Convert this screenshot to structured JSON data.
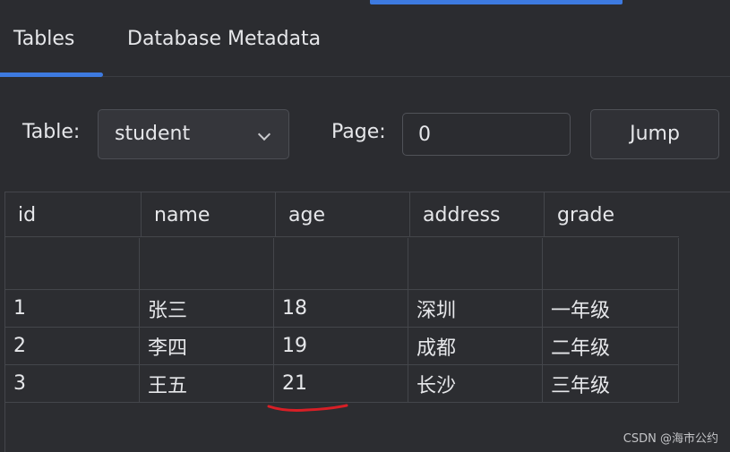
{
  "tabs": [
    {
      "label": "Tables",
      "active": true
    },
    {
      "label": "Database Metadata",
      "active": false
    }
  ],
  "toolbar": {
    "table_label": "Table:",
    "table_value": "student",
    "page_label": "Page:",
    "page_value": "0",
    "jump_label": "Jump"
  },
  "table": {
    "columns": [
      "id",
      "name",
      "age",
      "address",
      "grade"
    ],
    "rows": [
      [
        "",
        "",
        "",
        "",
        ""
      ],
      [
        "1",
        "张三",
        "18",
        "深圳",
        "一年级"
      ],
      [
        "2",
        "李四",
        "19",
        "成都",
        "二年级"
      ],
      [
        "3",
        "王五",
        "21",
        "长沙",
        "三年级"
      ]
    ]
  },
  "watermark": "CSDN @海市公约",
  "colors": {
    "accent": "#3d7ae0",
    "annotation": "#d81f26",
    "background": "#2b2c30"
  }
}
